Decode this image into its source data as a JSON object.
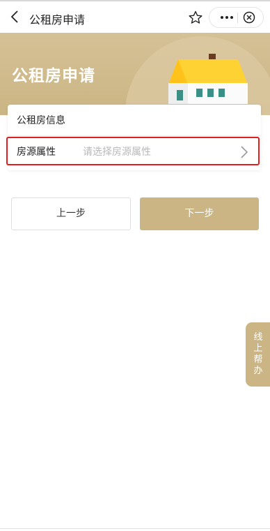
{
  "nav": {
    "title": "公租房申请"
  },
  "banner": {
    "title": "公租房申请"
  },
  "form": {
    "section_title": "公租房信息",
    "field_label": "房源属性",
    "field_placeholder": "请选择房源属性"
  },
  "actions": {
    "prev_label": "上一步",
    "next_label": "下一步"
  },
  "help": {
    "label": "线上帮办"
  },
  "icons": {
    "back": "chevron-left-icon",
    "favorite": "star-icon",
    "more": "more-dots-icon",
    "close": "close-circle-icon",
    "field_arrow": "chevron-right-icon"
  },
  "colors": {
    "accent": "#cbb585",
    "banner": "#d5c196",
    "highlight": "#e02020",
    "placeholder": "#b9b9b9"
  }
}
